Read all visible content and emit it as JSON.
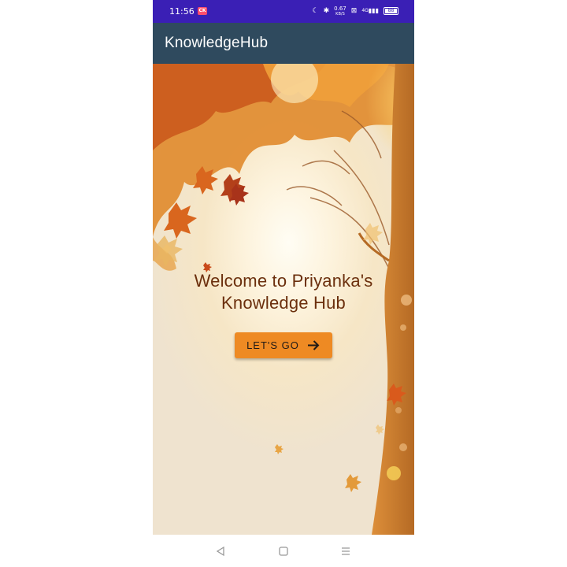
{
  "status_bar": {
    "time": "11:56",
    "notification_badge": "CK",
    "speed_value": "0.67",
    "speed_unit": "KB/S",
    "network": "4G",
    "battery": "88"
  },
  "app_bar": {
    "title": "KnowledgeHub"
  },
  "main": {
    "welcome_line1": "Welcome to Priyanka's",
    "welcome_line2": "Knowledge Hub",
    "button_label": "LET'S GO"
  },
  "nav_bar": {
    "back_icon": "triangle-back-icon",
    "home_icon": "square-home-icon",
    "menu_icon": "three-lines-menu-icon"
  },
  "colors": {
    "status_bar": "#3a1fb5",
    "app_bar": "#2f4a5e",
    "button": "#ee8a23",
    "welcome_text": "#6b2f0d",
    "tree_trunk": "#c8772a"
  }
}
